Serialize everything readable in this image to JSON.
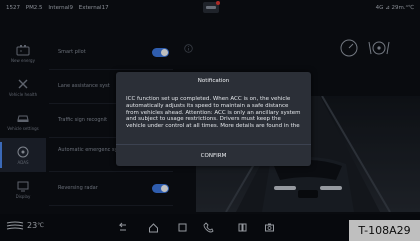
{
  "status": {
    "left_items": [
      "1527",
      "PM2.5",
      "Internal9",
      "External17"
    ],
    "right": "4G ⊿ 29m.⁴℃"
  },
  "sidebar": {
    "items": [
      {
        "label": "New energy",
        "icon": "battery-icon"
      },
      {
        "label": "Vehicle health",
        "icon": "wrench-icon"
      },
      {
        "label": "Vehicle settings",
        "icon": "car-icon"
      },
      {
        "label": "ADAS",
        "icon": "steering-wheel-icon",
        "active": true
      },
      {
        "label": "Display",
        "icon": "screen-icon"
      }
    ]
  },
  "settings": {
    "rows": [
      {
        "label": "Smart pilot",
        "toggle": true
      },
      {
        "label": "Lane assistance syst",
        "toggle": false
      },
      {
        "label": "Traffic sign recognit",
        "toggle": false
      },
      {
        "label": "Automatic emergenc system",
        "toggle": false
      },
      {
        "label": "Reversing radar",
        "toggle": true
      }
    ]
  },
  "dialog": {
    "title": "Notification",
    "body": "ICC function set up completed. When ACC is on, the vehicle automatically adjusts its speed to maintain a safe distance from vehicles ahead. Attention: ACC is only an ancillary system and subject to usage restrictions. Drivers must keep the vehicle under control at all times. More details are found in the",
    "confirm_label": "CONFIRM"
  },
  "bottom": {
    "temperature": "23",
    "temperature_unit": "℃",
    "dock_icons": [
      "back-icon",
      "home-icon",
      "recents-icon",
      "phone-icon",
      "apps-icon",
      "camera-icon"
    ]
  },
  "tag": "T-108A29",
  "colors": {
    "accent": "#3f7de8",
    "background": "#0c0f14",
    "dialog": "#2b2f37"
  }
}
